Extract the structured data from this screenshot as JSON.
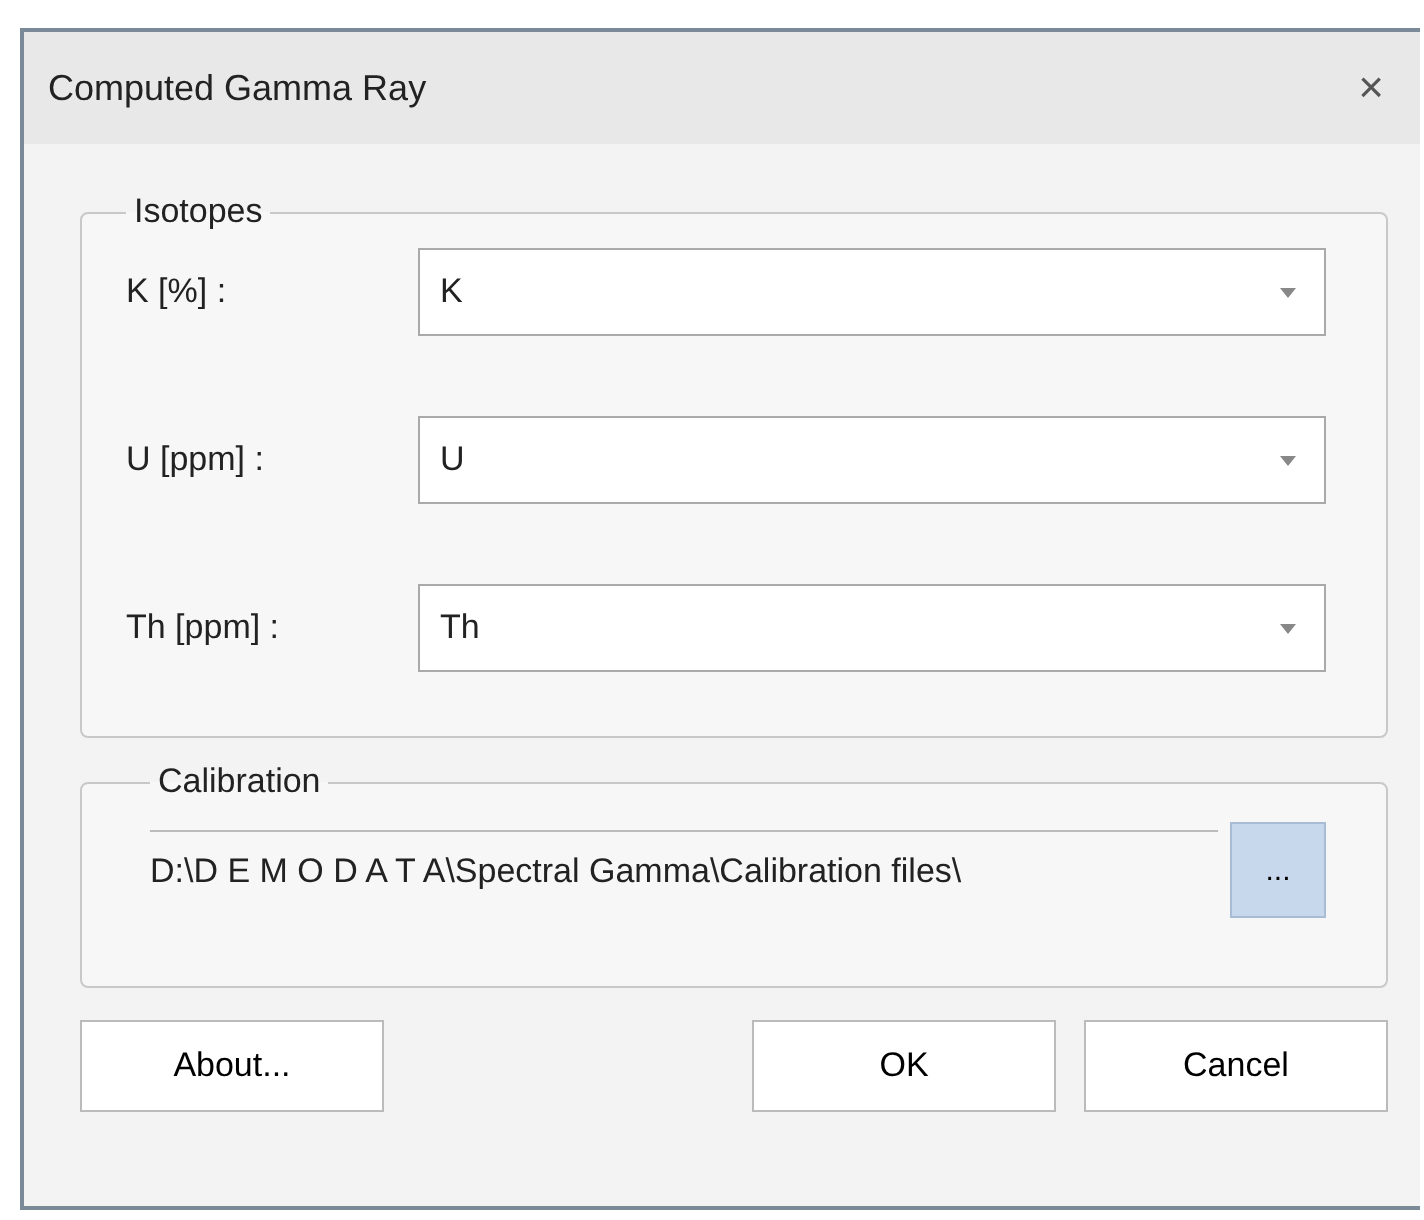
{
  "window": {
    "title": "Computed Gamma Ray",
    "close": "×"
  },
  "isotopes": {
    "title": "Isotopes",
    "rows": [
      {
        "label": "K [%] :",
        "value": "K"
      },
      {
        "label": "U [ppm] :",
        "value": "U"
      },
      {
        "label": "Th [ppm] :",
        "value": "Th"
      }
    ]
  },
  "calibration": {
    "title": "Calibration",
    "path": "D:\\D E M O D A T A\\Spectral Gamma\\Calibration files\\",
    "browse": "..."
  },
  "buttons": {
    "about": "About...",
    "ok": "OK",
    "cancel": "Cancel"
  }
}
